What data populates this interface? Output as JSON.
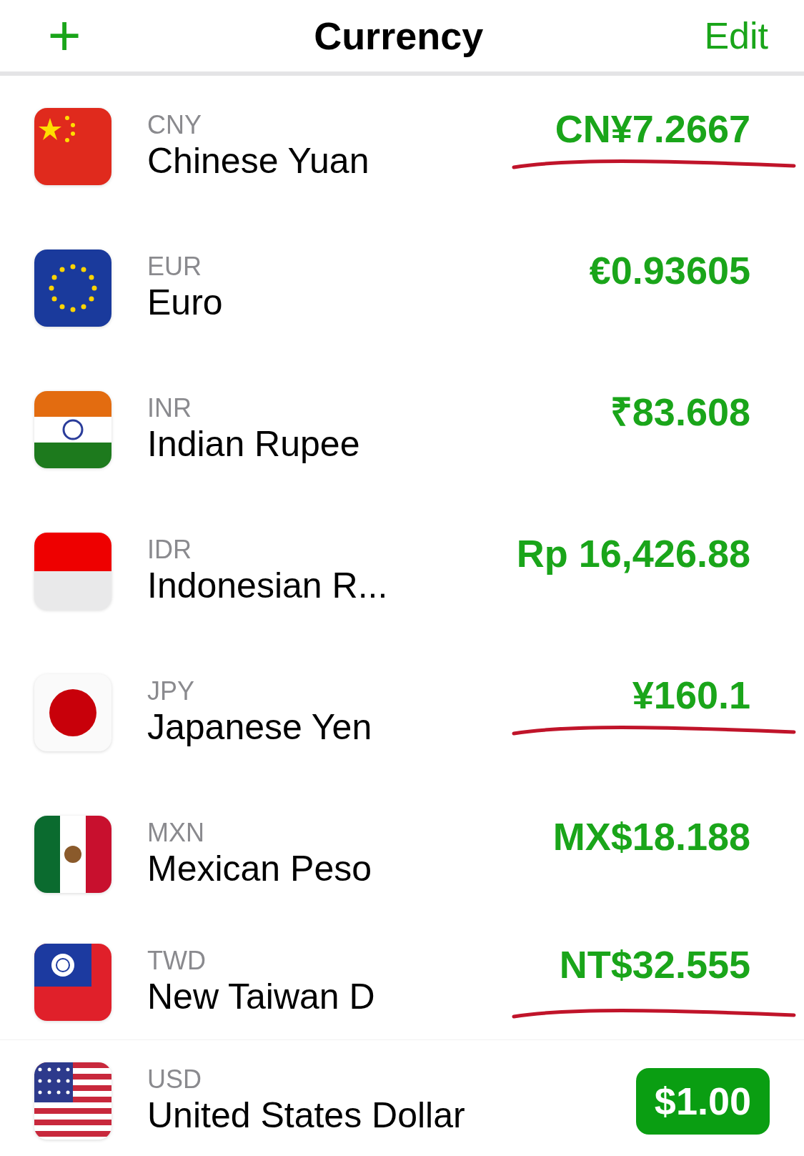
{
  "nav": {
    "add_symbol": "+",
    "title": "Currency",
    "edit": "Edit"
  },
  "rows": [
    {
      "code": "CNY",
      "name": "Chinese Yuan",
      "value": "CN¥7.2667",
      "underlined": true
    },
    {
      "code": "EUR",
      "name": "Euro",
      "value": "€0.93605",
      "underlined": false
    },
    {
      "code": "INR",
      "name": "Indian Rupee",
      "value": "₹83.608",
      "underlined": false
    },
    {
      "code": "IDR",
      "name": "Indonesian R...",
      "value": "Rp 16,426.88",
      "underlined": false
    },
    {
      "code": "JPY",
      "name": "Japanese Yen",
      "value": "¥160.1",
      "underlined": true
    },
    {
      "code": "MXN",
      "name": "Mexican Peso",
      "value": "MX$18.188",
      "underlined": false
    },
    {
      "code": "TWD",
      "name": "New Taiwan D",
      "value": "NT$32.555",
      "underlined": true
    }
  ],
  "base": {
    "code": "USD",
    "name": "United States Dollar",
    "value": "$1.00",
    "selected": true
  }
}
